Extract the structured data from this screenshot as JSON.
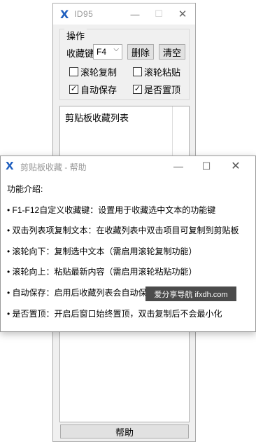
{
  "main_window": {
    "title": "ID95",
    "group_label": "操作",
    "favorite_key_label": "收藏键:",
    "favorite_key_value": "F4",
    "delete_button": "删除",
    "clear_button": "清空",
    "checkboxes": [
      {
        "label": "滚轮复制",
        "checked": false
      },
      {
        "label": "滚轮粘贴",
        "checked": false
      },
      {
        "label": "自动保存",
        "checked": true
      },
      {
        "label": "是否置顶",
        "checked": true
      }
    ],
    "list_header": "剪贴板收藏列表",
    "help_button": "帮助"
  },
  "help_window": {
    "title": "剪贴板收藏 - 帮助",
    "intro": "功能介绍:",
    "lines": [
      "• F1-F12自定义收藏键：设置用于收藏选中文本的功能键",
      "• 双击列表项复制文本：在收藏列表中双击项目可复制到剪贴板",
      "• 滚轮向下：复制选中文本（需启用滚轮复制功能）",
      "• 滚轮向上：粘贴最新内容（需启用滚轮粘贴功能）",
      "• 自动保存：启用后收藏列表会自动保",
      "• 是否置顶：开启后窗口始终置顶，双击复制后不会最小化"
    ]
  },
  "watermark": "爱分享导航 ifxdh.com",
  "icons": {
    "app": "app-x-logo-icon",
    "minimize": "minimize-icon",
    "maximize": "maximize-icon",
    "close": "close-icon",
    "check": "checkmark-icon",
    "dropdown": "chevron-down-icon"
  },
  "colors": {
    "app_logo": "#1f5fbf",
    "window_bg": "#f0f0f0",
    "button_bg": "#e1e1e1"
  }
}
